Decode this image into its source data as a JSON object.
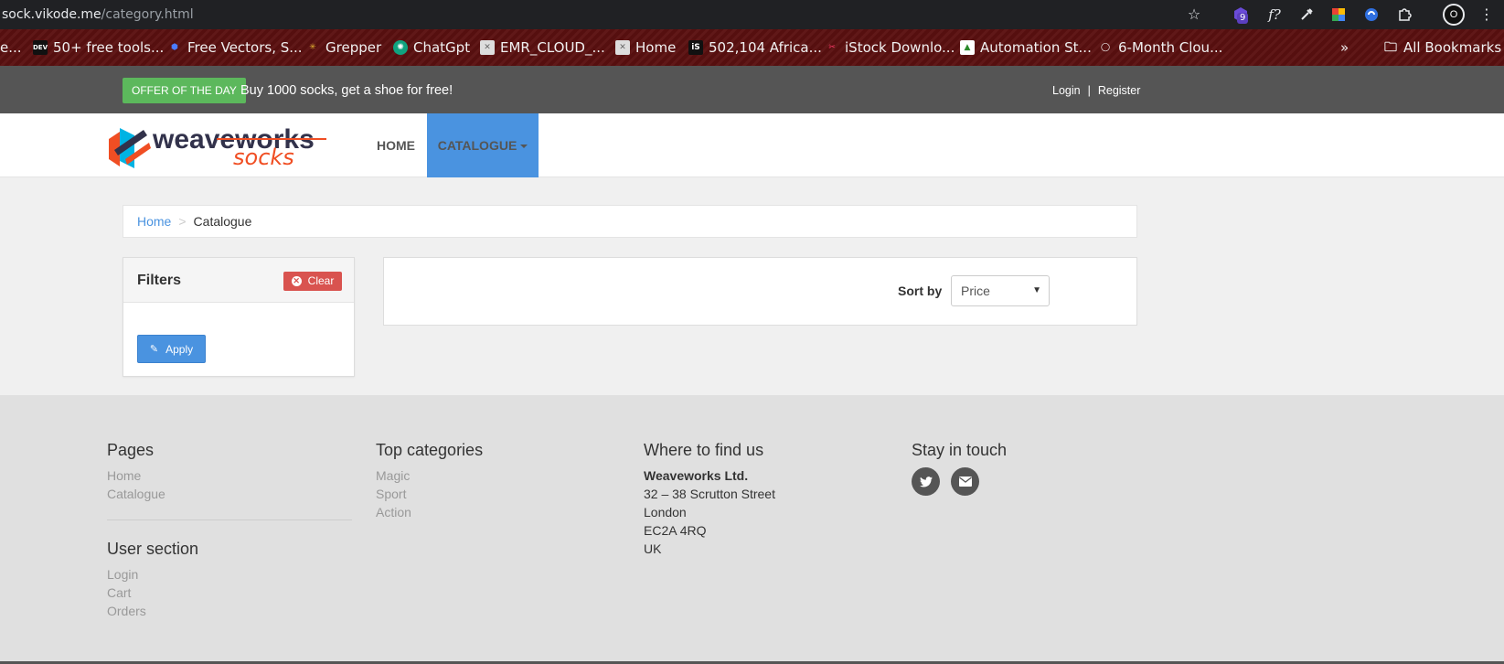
{
  "browser": {
    "url_host": "sock.vikode.me",
    "url_path": "/category.html",
    "extension_badge": "9",
    "profile_initial": "O",
    "bookmarks": [
      {
        "label": "e..."
      },
      {
        "label": "50+ free tools..."
      },
      {
        "label": "Free Vectors, S..."
      },
      {
        "label": "Grepper"
      },
      {
        "label": "ChatGpt"
      },
      {
        "label": "EMR_CLOUD_..."
      },
      {
        "label": "Home"
      },
      {
        "label": "502,104 Africa..."
      },
      {
        "label": "iStock Downlo..."
      },
      {
        "label": "Automation St..."
      },
      {
        "label": "6-Month Clou..."
      }
    ],
    "more_label": "»",
    "all_bookmarks_label": "All Bookmarks",
    "dev_icon_text": "DEV",
    "is_icon_text": "iS"
  },
  "topbar": {
    "offer_badge": "OFFER OF THE DAY",
    "offer_text": "Buy 1000 socks, get a shoe for free!",
    "login": "Login",
    "separator": "|",
    "register": "Register"
  },
  "navbar": {
    "logo_word1": "weaveworks",
    "logo_word2": "socks",
    "home": "HOME",
    "catalogue": "CATALOGUE"
  },
  "breadcrumb": {
    "home": "Home",
    "separator": ">",
    "current": "Catalogue"
  },
  "filters": {
    "title": "Filters",
    "clear": "Clear",
    "apply": "Apply"
  },
  "sort": {
    "label": "Sort by",
    "selected": "Price"
  },
  "footer": {
    "pages": {
      "title": "Pages",
      "links": [
        "Home",
        "Catalogue"
      ]
    },
    "user_section": {
      "title": "User section",
      "links": [
        "Login",
        "Cart",
        "Orders"
      ]
    },
    "top_categories": {
      "title": "Top categories",
      "links": [
        "Magic",
        "Sport",
        "Action"
      ]
    },
    "where": {
      "title": "Where to find us",
      "company": "Weaveworks Ltd.",
      "lines": [
        "32 – 38 Scrutton Street",
        "London",
        "EC2A 4RQ",
        "UK"
      ]
    },
    "stay": {
      "title": "Stay in touch"
    }
  },
  "colors": {
    "accent_blue": "#4a93e0",
    "offer_green": "#5cb85c",
    "clear_red": "#d9534f",
    "topbar_grey": "#555555",
    "logo_orange": "#f04e23"
  }
}
